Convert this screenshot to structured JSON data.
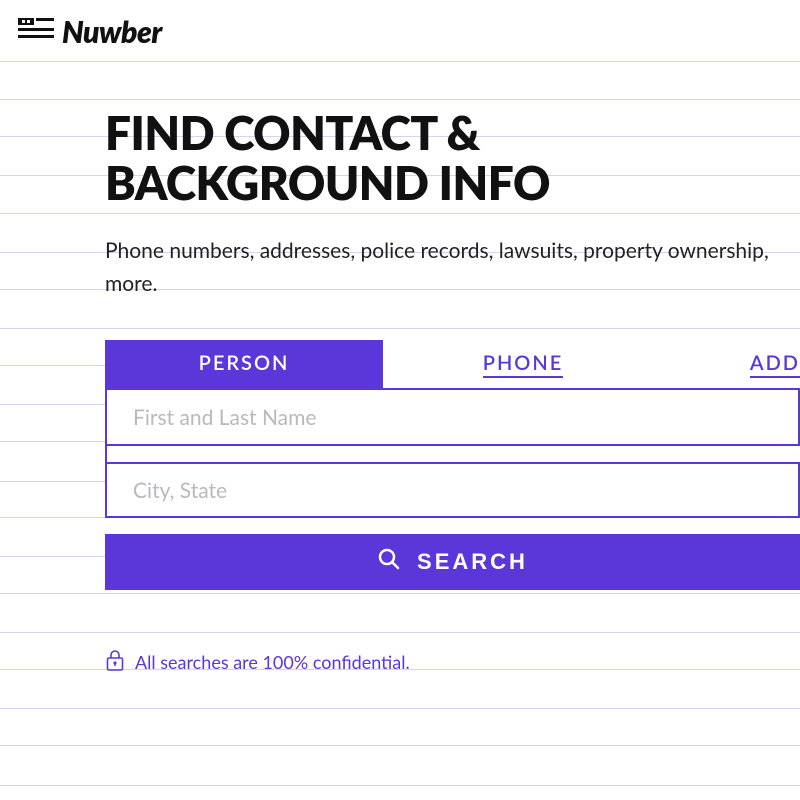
{
  "brand": {
    "name": "Nuwber"
  },
  "hero": {
    "title_line1": "FIND CONTACT &",
    "title_line2": "BACKGROUND INFO",
    "subtitle": "Phone numbers, addresses, police records, lawsuits, property ownership, more."
  },
  "tabs": {
    "person": "PERSON",
    "phone": "PHONE",
    "address": "ADD"
  },
  "inputs": {
    "name_placeholder": "First and Last Name",
    "location_placeholder": "City, State"
  },
  "search": {
    "label": "SEARCH"
  },
  "confidential": {
    "text": "All searches are 100% confidential."
  },
  "colors": {
    "accent": "#5b36d8"
  }
}
